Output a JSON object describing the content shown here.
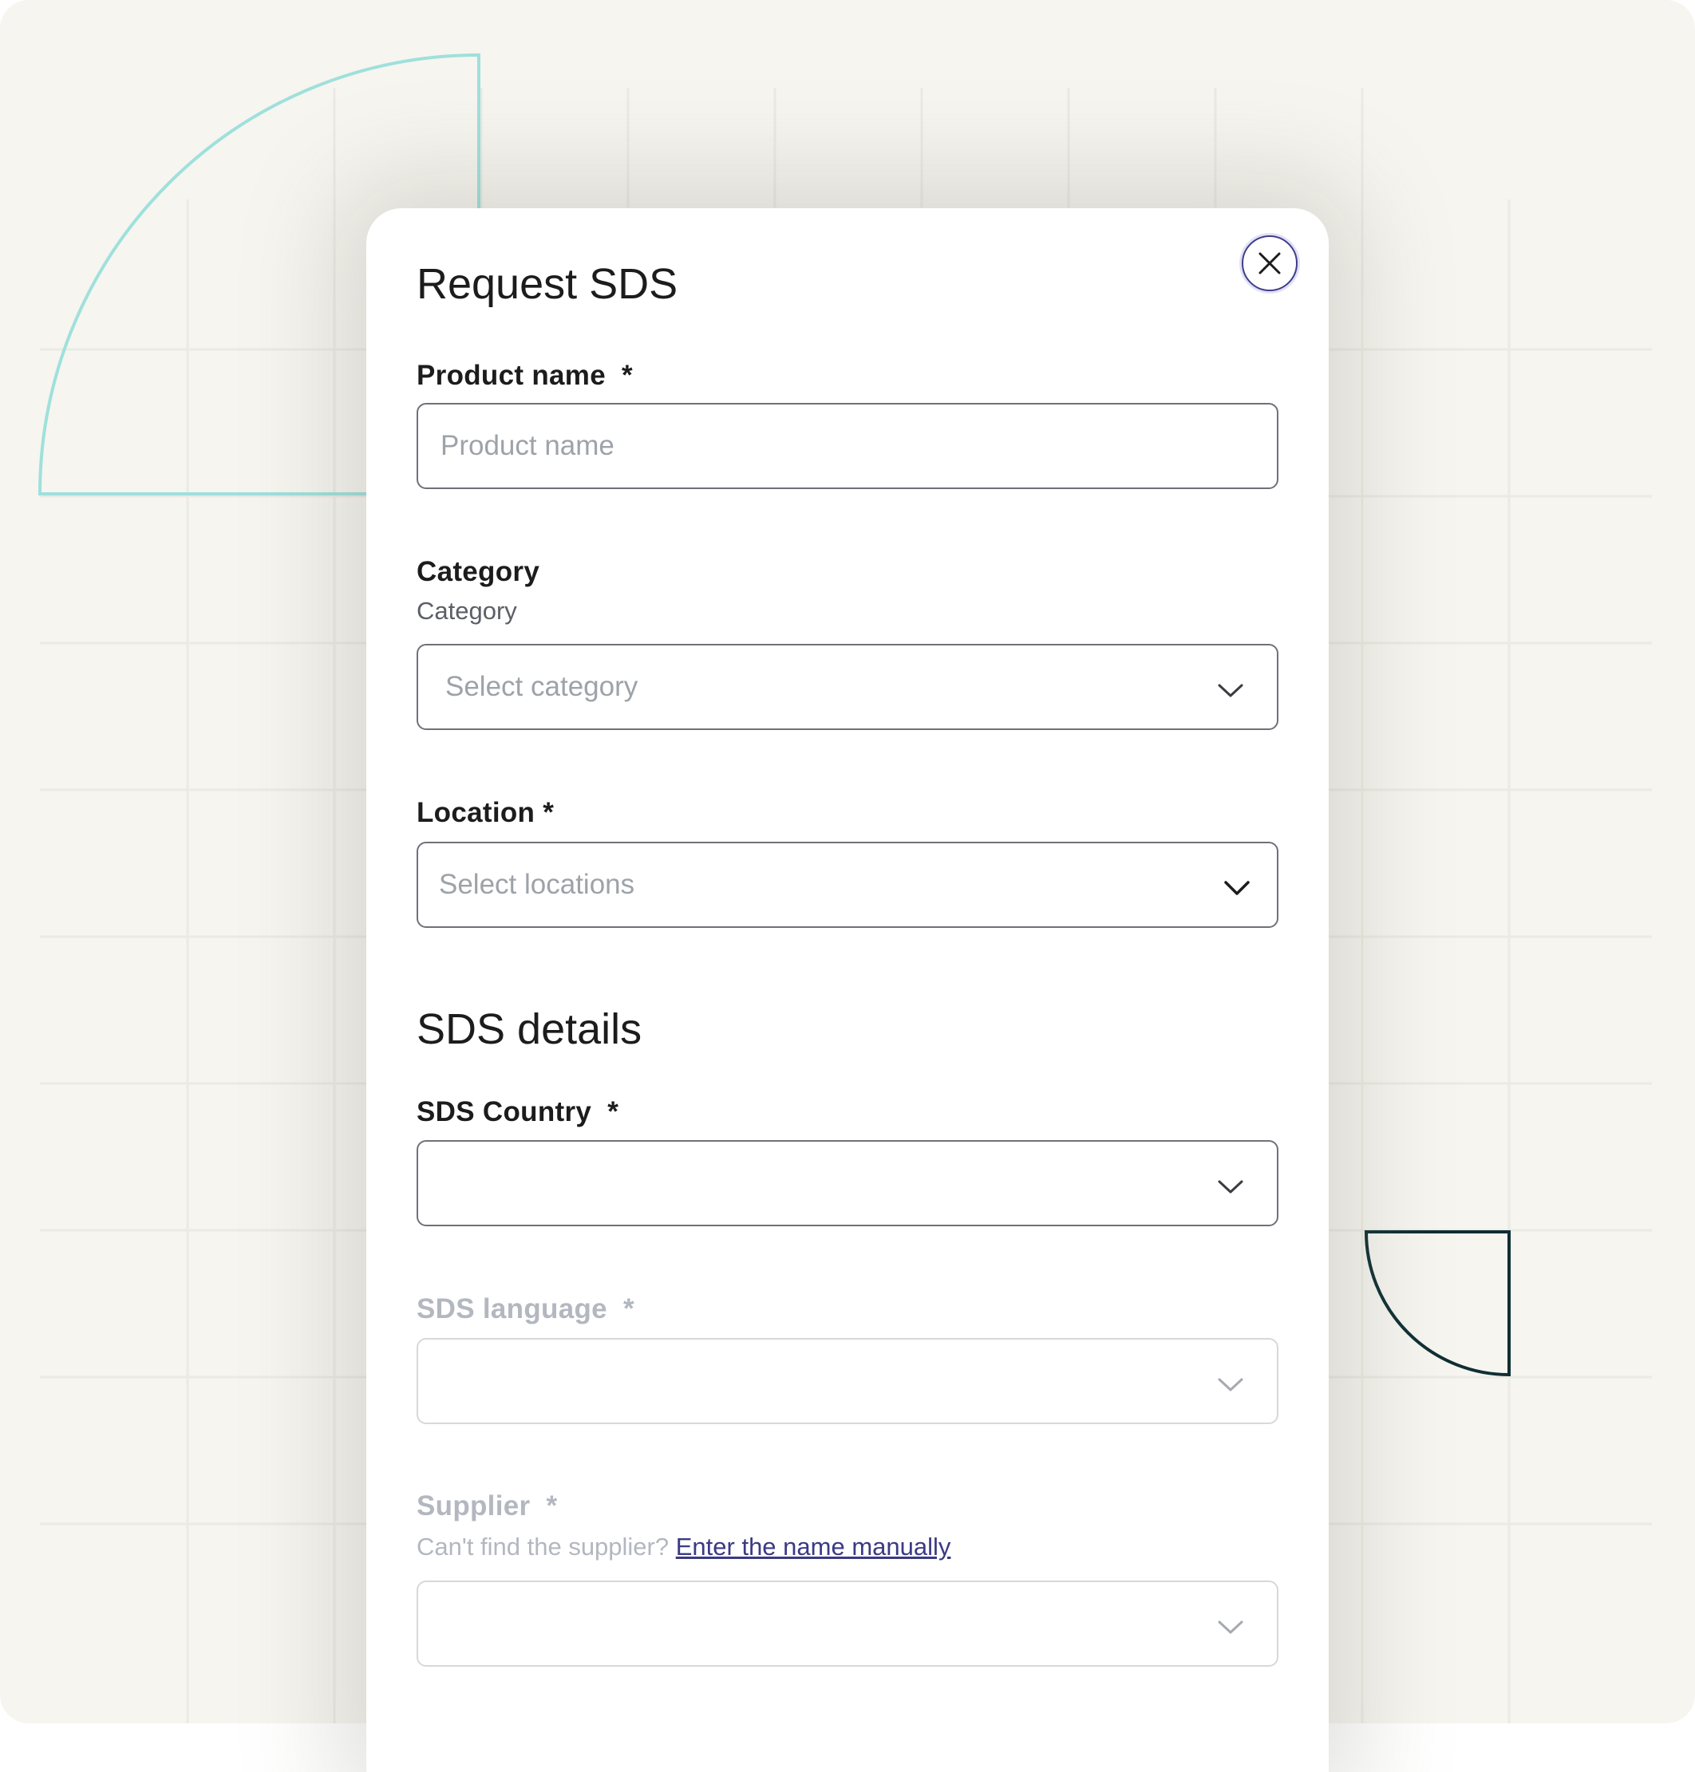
{
  "dialog": {
    "title": "Request SDS",
    "close_icon": "close-icon"
  },
  "fields": {
    "product_name": {
      "label": "Product name",
      "required_mark": "*",
      "placeholder": "Product name",
      "value": ""
    },
    "category": {
      "label": "Category",
      "helper": "Category",
      "placeholder": "Select category",
      "icon": "chevron-down-icon"
    },
    "location": {
      "label": "Location",
      "required_mark": "*",
      "placeholder": "Select locations",
      "icon": "chevron-down-icon"
    }
  },
  "sds_details": {
    "title": "SDS details",
    "country": {
      "label": "SDS Country",
      "required_mark": "*",
      "value": "",
      "icon": "chevron-down-icon"
    },
    "language": {
      "label": "SDS language",
      "required_mark": "*",
      "value": "",
      "icon": "chevron-down-icon",
      "disabled": true
    },
    "supplier": {
      "label": "Supplier",
      "required_mark": "*",
      "helper": "Can't find the supplier?",
      "helper_link": "Enter the name manually",
      "value": "",
      "icon": "chevron-down-icon",
      "disabled": true
    }
  },
  "colors": {
    "background": "#f6f5f0",
    "accent_teal_outline": "#9fe0dc",
    "dark_outline": "#0f2f33",
    "link": "#3a3a84",
    "focus_ring": "#3f3d8e"
  }
}
